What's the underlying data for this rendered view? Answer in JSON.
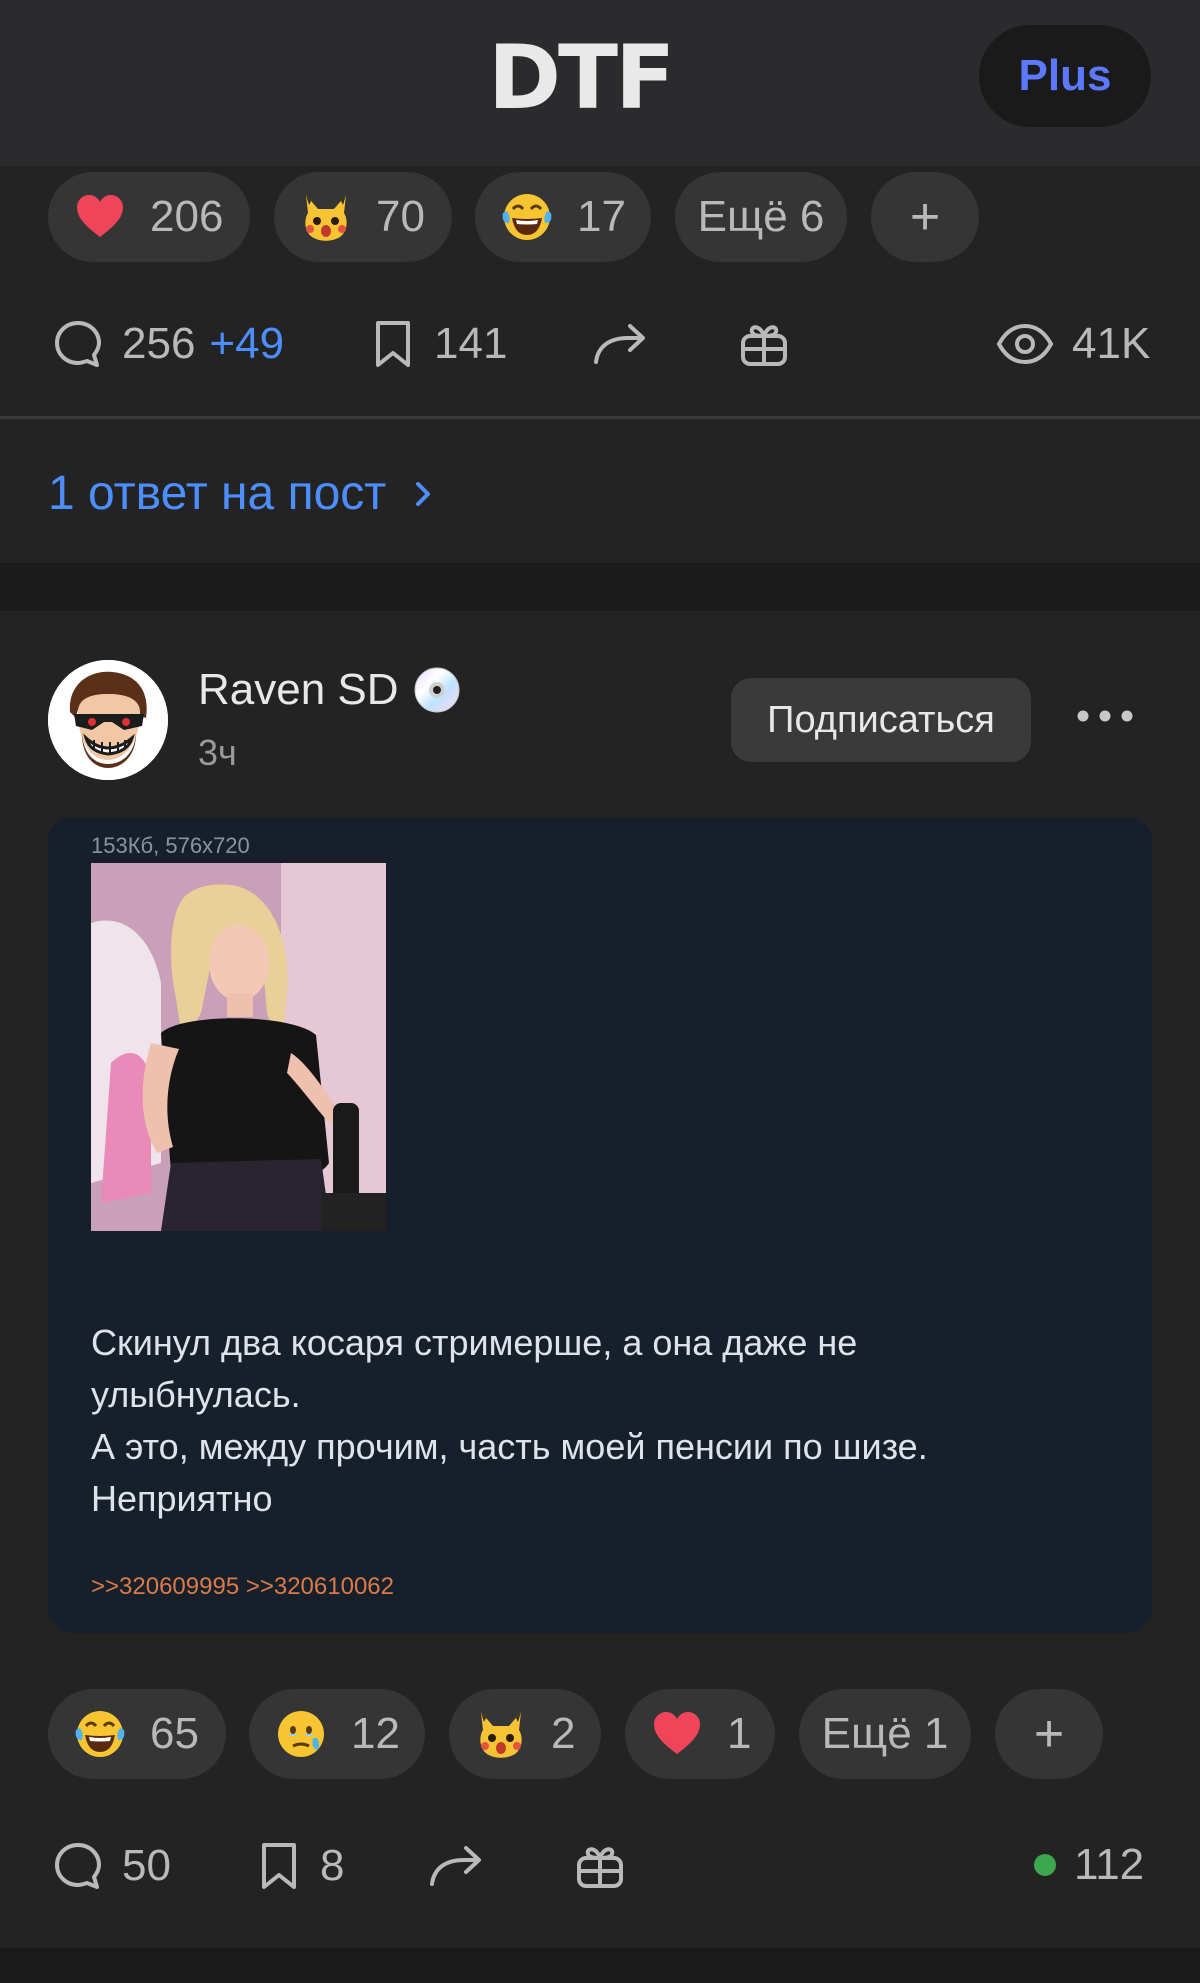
{
  "header": {
    "logo": "DTF",
    "plus_label": "Plus"
  },
  "post1": {
    "reactions": [
      {
        "icon": "heart-emoji",
        "count": "206"
      },
      {
        "icon": "pikachu-emoji",
        "count": "70"
      },
      {
        "icon": "laughing-tears-emoji",
        "count": "17"
      }
    ],
    "more_reactions_label": "Ещё 6",
    "add_reaction_label": "+",
    "comments_count": "256",
    "comments_new": "+49",
    "bookmarks_count": "141",
    "views_count": "41K",
    "reply_link_label": "1 ответ на пост"
  },
  "post2": {
    "author_name": "Raven SD",
    "author_badge_icon": "cd-disc-emoji",
    "time": "3ч",
    "subscribe_label": "Подписаться",
    "file_info": "153Кб, 576x720",
    "text": "Скинул два косаря стримерше, а она даже не\nулыбнулась.\nА это, между прочим, часть моей пенсии по шизе.\nНеприятно",
    "refs": ">>320609995 >>320610062",
    "reactions": [
      {
        "icon": "laughing-tears-emoji",
        "count": "65"
      },
      {
        "icon": "holding-tears-emoji",
        "count": "12"
      },
      {
        "icon": "pikachu-emoji",
        "count": "2"
      },
      {
        "icon": "heart-emoji",
        "count": "1"
      }
    ],
    "more_reactions_label": "Ещё 1",
    "add_reaction_label": "+",
    "comments_count": "50",
    "bookmarks_count": "8",
    "online_count": "112"
  },
  "colors": {
    "accent_blue": "#4d8eff",
    "plus_blue": "#5b78ff",
    "online_green": "#3ca74d",
    "ref_orange": "#d97a4a"
  }
}
